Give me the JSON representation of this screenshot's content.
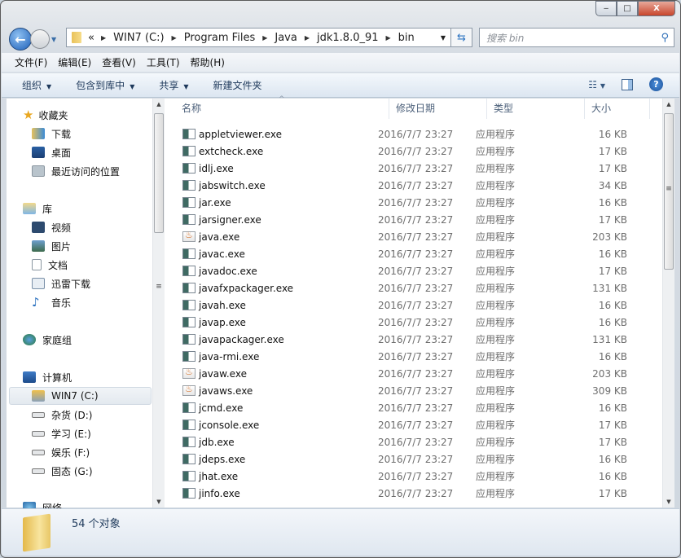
{
  "window": {
    "caption": {
      "minimize": "‒",
      "maximize": "□",
      "close": "X"
    }
  },
  "address_bar": {
    "overflow": "«",
    "crumbs": [
      "WIN7 (C:)",
      "Program Files",
      "Java",
      "jdk1.8.0_91",
      "bin"
    ]
  },
  "search": {
    "placeholder": "搜索 bin"
  },
  "menu": [
    "文件(F)",
    "编辑(E)",
    "查看(V)",
    "工具(T)",
    "帮助(H)"
  ],
  "toolbar": {
    "organize": "组织",
    "include_in_library": "包含到库中",
    "share": "共享",
    "new_folder": "新建文件夹"
  },
  "nav_pane": {
    "favorites": {
      "label": "收藏夹",
      "items": [
        "下载",
        "桌面",
        "最近访问的位置"
      ]
    },
    "libraries": {
      "label": "库",
      "items": [
        "视频",
        "图片",
        "文档",
        "迅雷下载",
        "音乐"
      ]
    },
    "homegroup": "家庭组",
    "computer": {
      "label": "计算机",
      "items": [
        "WIN7 (C:)",
        "杂货 (D:)",
        "学习 (E:)",
        "娱乐 (F:)",
        "固态 (G:)"
      ],
      "selected": "WIN7 (C:)"
    },
    "network": "网络"
  },
  "columns": {
    "name": "名称",
    "date": "修改日期",
    "type": "类型",
    "size": "大小"
  },
  "files": [
    {
      "name": "appletviewer.exe",
      "date": "2016/7/7 23:27",
      "type": "应用程序",
      "size": "16 KB",
      "icon": "exe"
    },
    {
      "name": "extcheck.exe",
      "date": "2016/7/7 23:27",
      "type": "应用程序",
      "size": "17 KB",
      "icon": "exe"
    },
    {
      "name": "idlj.exe",
      "date": "2016/7/7 23:27",
      "type": "应用程序",
      "size": "17 KB",
      "icon": "exe"
    },
    {
      "name": "jabswitch.exe",
      "date": "2016/7/7 23:27",
      "type": "应用程序",
      "size": "34 KB",
      "icon": "exe"
    },
    {
      "name": "jar.exe",
      "date": "2016/7/7 23:27",
      "type": "应用程序",
      "size": "16 KB",
      "icon": "exe"
    },
    {
      "name": "jarsigner.exe",
      "date": "2016/7/7 23:27",
      "type": "应用程序",
      "size": "17 KB",
      "icon": "exe"
    },
    {
      "name": "java.exe",
      "date": "2016/7/7 23:27",
      "type": "应用程序",
      "size": "203 KB",
      "icon": "java"
    },
    {
      "name": "javac.exe",
      "date": "2016/7/7 23:27",
      "type": "应用程序",
      "size": "16 KB",
      "icon": "exe"
    },
    {
      "name": "javadoc.exe",
      "date": "2016/7/7 23:27",
      "type": "应用程序",
      "size": "17 KB",
      "icon": "exe"
    },
    {
      "name": "javafxpackager.exe",
      "date": "2016/7/7 23:27",
      "type": "应用程序",
      "size": "131 KB",
      "icon": "exe"
    },
    {
      "name": "javah.exe",
      "date": "2016/7/7 23:27",
      "type": "应用程序",
      "size": "16 KB",
      "icon": "exe"
    },
    {
      "name": "javap.exe",
      "date": "2016/7/7 23:27",
      "type": "应用程序",
      "size": "16 KB",
      "icon": "exe"
    },
    {
      "name": "javapackager.exe",
      "date": "2016/7/7 23:27",
      "type": "应用程序",
      "size": "131 KB",
      "icon": "exe"
    },
    {
      "name": "java-rmi.exe",
      "date": "2016/7/7 23:27",
      "type": "应用程序",
      "size": "16 KB",
      "icon": "exe"
    },
    {
      "name": "javaw.exe",
      "date": "2016/7/7 23:27",
      "type": "应用程序",
      "size": "203 KB",
      "icon": "java"
    },
    {
      "name": "javaws.exe",
      "date": "2016/7/7 23:27",
      "type": "应用程序",
      "size": "309 KB",
      "icon": "java"
    },
    {
      "name": "jcmd.exe",
      "date": "2016/7/7 23:27",
      "type": "应用程序",
      "size": "16 KB",
      "icon": "exe"
    },
    {
      "name": "jconsole.exe",
      "date": "2016/7/7 23:27",
      "type": "应用程序",
      "size": "17 KB",
      "icon": "exe"
    },
    {
      "name": "jdb.exe",
      "date": "2016/7/7 23:27",
      "type": "应用程序",
      "size": "17 KB",
      "icon": "exe"
    },
    {
      "name": "jdeps.exe",
      "date": "2016/7/7 23:27",
      "type": "应用程序",
      "size": "16 KB",
      "icon": "exe"
    },
    {
      "name": "jhat.exe",
      "date": "2016/7/7 23:27",
      "type": "应用程序",
      "size": "16 KB",
      "icon": "exe"
    },
    {
      "name": "jinfo.exe",
      "date": "2016/7/7 23:27",
      "type": "应用程序",
      "size": "17 KB",
      "icon": "exe"
    }
  ],
  "status": {
    "count": "54 个对象"
  }
}
